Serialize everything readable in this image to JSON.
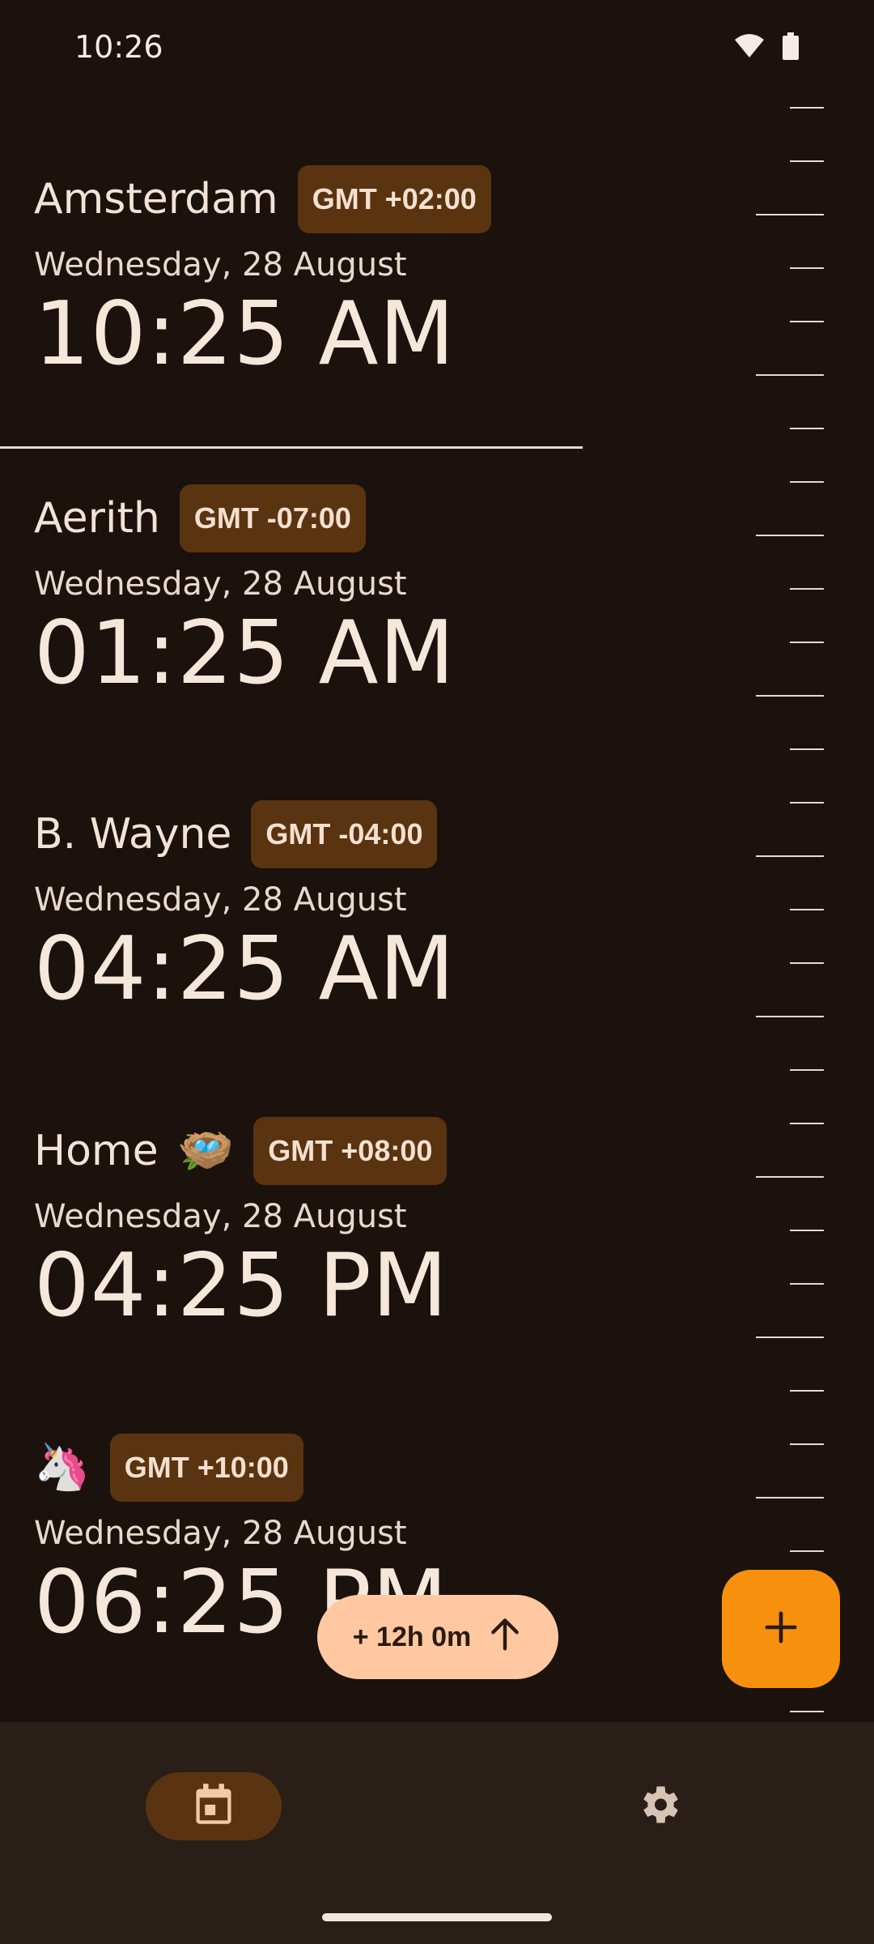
{
  "status": {
    "time": "10:26",
    "icons": [
      "wifi-icon",
      "battery-icon"
    ]
  },
  "clocks": [
    {
      "name": "Amsterdam",
      "emoji": "",
      "tz": "GMT +02:00",
      "date": "Wednesday, 28 August",
      "time": "10:25 AM"
    },
    {
      "name": "Aerith",
      "emoji": "",
      "tz": "GMT -07:00",
      "date": "Wednesday, 28 August",
      "time": "01:25 AM"
    },
    {
      "name": "B. Wayne",
      "emoji": "",
      "tz": "GMT -04:00",
      "date": "Wednesday, 28 August",
      "time": "04:25 AM"
    },
    {
      "name": "Home",
      "emoji": "🪺",
      "tz": "GMT +08:00",
      "date": "Wednesday, 28 August",
      "time": "04:25 PM"
    },
    {
      "name": "",
      "emoji": "🦄",
      "tz": "GMT +10:00",
      "date": "Wednesday, 28 August",
      "time": "06:25 PM"
    }
  ],
  "offset_chip": {
    "label": "+ 12h 0m",
    "icon": "arrow-up-icon"
  },
  "fab": {
    "icon": "plus-icon"
  },
  "bottom_nav": {
    "items": [
      {
        "icon": "calendar-icon",
        "selected": true
      },
      {
        "icon": "gear-icon",
        "selected": false
      }
    ]
  },
  "colors": {
    "background": "#1b120e",
    "accent": "#f7900d",
    "chip": "#5a3410",
    "offset_chip": "#ffc8a0"
  }
}
